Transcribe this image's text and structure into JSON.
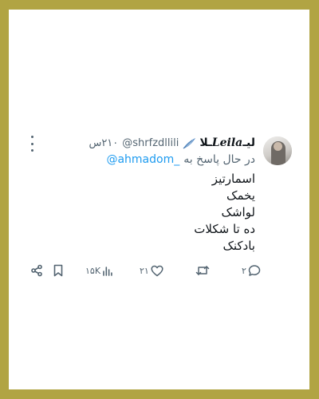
{
  "tweet": {
    "display_name_prefix": "لیـ",
    "display_name_latin": "Leila",
    "display_name_suffix": "ـلا",
    "handle": "@shrfzdllili",
    "time": "۲۱۰س",
    "reply_prefix": "در حال پاسخ به",
    "reply_mention": "@ahmadom_",
    "body_lines": [
      "اسمارتیز",
      "یخمک",
      "لواشک",
      "ده تا شکلات",
      "بادکنک"
    ],
    "counts": {
      "replies": "۲",
      "retweets": "",
      "likes": "۲۱",
      "views": "۱۵K"
    }
  },
  "icons": {
    "more": "more-horizontal-icon",
    "verified": "feather-emoji-icon",
    "reply": "speech-bubble-icon",
    "retweet": "retweet-arrows-icon",
    "like": "heart-icon",
    "views": "bar-chart-icon",
    "bookmark": "bookmark-icon",
    "share": "share-nodes-icon"
  },
  "colors": {
    "frame": "#b1a443",
    "card": "#ffffff",
    "text": "#0f1419",
    "muted": "#536471",
    "link": "#1d9bf0"
  }
}
